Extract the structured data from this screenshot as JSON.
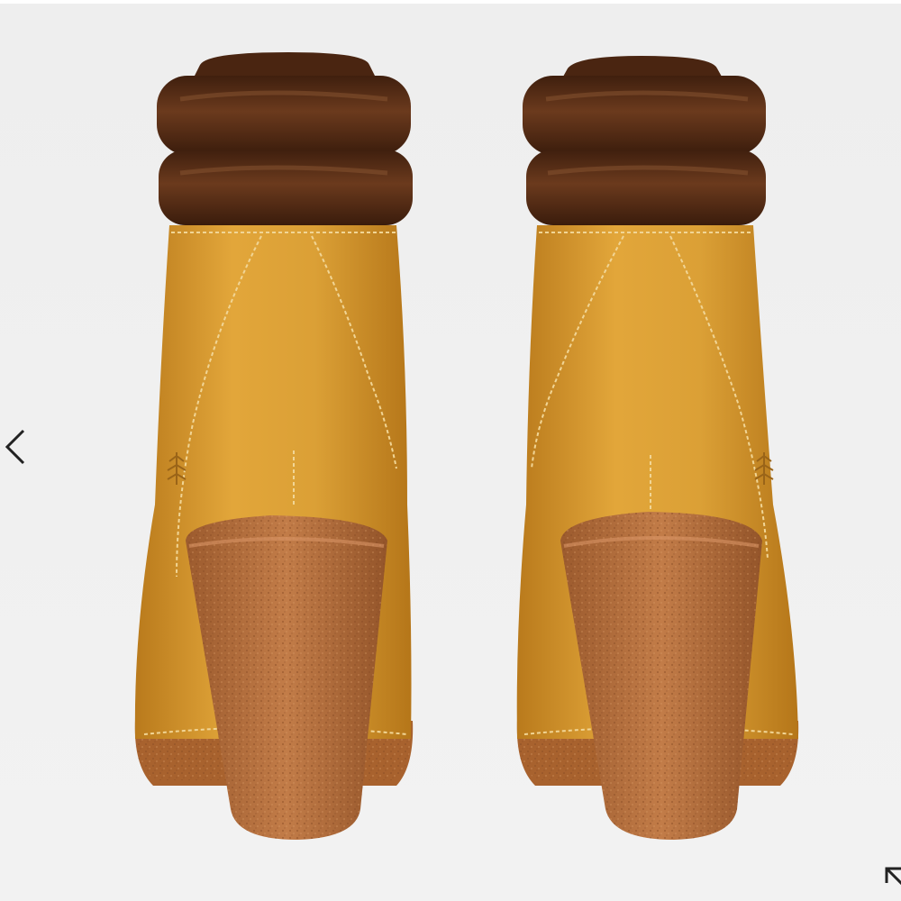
{
  "gallery": {
    "image_subject": "boots",
    "prev_icon": "chevron-left-icon",
    "fullscreen_icon": "expand-icon",
    "colors": {
      "background": "#f0f0f0",
      "nubuck": "#d4962c",
      "collar_leather": "#5a2f17",
      "heel_rubber": "#b8703f",
      "stitching": "#e9c98a"
    }
  }
}
